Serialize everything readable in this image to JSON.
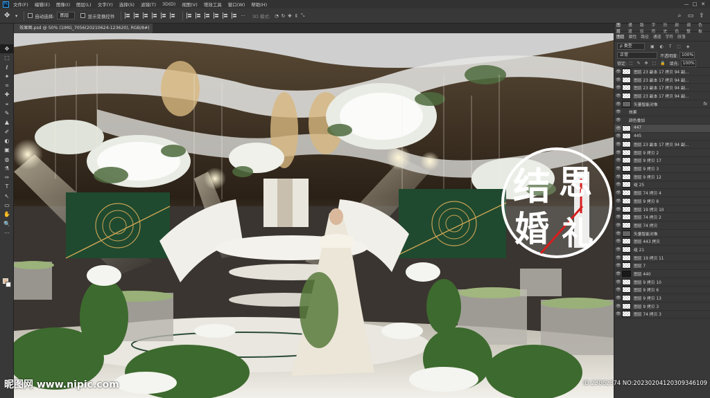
{
  "menu": {
    "items": [
      "文件(F)",
      "编辑(E)",
      "图像(I)",
      "图层(L)",
      "文字(Y)",
      "选择(S)",
      "滤镜(T)",
      "3D(D)",
      "视图(V)",
      "增效工具",
      "窗口(W)",
      "帮助(H)"
    ]
  },
  "window_controls": {
    "minimize": "—",
    "maximize": "□",
    "close": "✕"
  },
  "options": {
    "auto_select_label": "自动选择:",
    "auto_select_value": "图层",
    "show_transform_label": "显示变换控件",
    "mode3d_label": "3D 模式:"
  },
  "document": {
    "tab_title": "效果图.psd @ 50% (1IMG_7056(20210624-123620), RGB/8#)",
    "close_glyph": "×"
  },
  "tools": [
    "✥",
    "⬚",
    "ℓ",
    "✦",
    "⌗",
    "✚",
    "⌖",
    "✎",
    "▲",
    "✐",
    "◐",
    "▣",
    "◍",
    "⚗",
    "✑",
    "T",
    "↖",
    "▭",
    "✋",
    "🔍",
    "⋯"
  ],
  "panel": {
    "tabs_row1": [
      "图层",
      "通道",
      "路径",
      "字符",
      "历史",
      "颜色",
      "调整",
      "色板"
    ],
    "tabs_row2": [
      "图层",
      "属性",
      "路径",
      "通道",
      "字符",
      "段落"
    ],
    "filter_label": "ρ 类型",
    "filter_icons": "▣ ◐ T ⬚ ◈",
    "blend_mode": "正常",
    "opacity_label": "不透明度:",
    "opacity_value": "100%",
    "lock_label": "锁定:",
    "lock_icons": "⬚ ✎ ✥ ⬚ 🔒",
    "fill_label": "填充:",
    "fill_value": "100%"
  },
  "layers": [
    {
      "name": "图层 23 副本 17 拷贝 94 副...",
      "type": "checker",
      "selected": false
    },
    {
      "name": "图层 23 副本 17 拷贝 94 副...",
      "type": "checker",
      "selected": false
    },
    {
      "name": "图层 23 副本 17 拷贝 94 副...",
      "type": "checker",
      "selected": false
    },
    {
      "name": "图层 23 副本 17 拷贝 94 副...",
      "type": "checker",
      "selected": false
    },
    {
      "name": "矢量智能对象",
      "type": "smart",
      "selected": false,
      "fx": "fx"
    },
    {
      "name": "效果",
      "type": "effect",
      "selected": false
    },
    {
      "name": "颜色叠加",
      "type": "effect",
      "selected": false
    },
    {
      "name": "447",
      "type": "checker",
      "selected": true
    },
    {
      "name": "445",
      "type": "checker",
      "selected": false
    },
    {
      "name": "图层 23 副本 17 拷贝 94 副...",
      "type": "checker",
      "selected": false
    },
    {
      "name": "图层 9 拷贝 2",
      "type": "checker",
      "selected": false
    },
    {
      "name": "图层 9 拷贝 17",
      "type": "checker",
      "selected": false
    },
    {
      "name": "图层 9 拷贝 3",
      "type": "checker",
      "selected": false
    },
    {
      "name": "图层 9 拷贝 12",
      "type": "checker",
      "selected": false
    },
    {
      "name": "组 25",
      "type": "checker",
      "selected": false
    },
    {
      "name": "图层 74 拷贝 4",
      "type": "checker",
      "selected": false
    },
    {
      "name": "图层 9 拷贝 8",
      "type": "checker",
      "selected": false
    },
    {
      "name": "图层 19 拷贝 10",
      "type": "checker",
      "selected": false
    },
    {
      "name": "图层 74 拷贝 2",
      "type": "checker",
      "selected": false
    },
    {
      "name": "图层 74 拷贝",
      "type": "checker",
      "selected": false
    },
    {
      "name": "矢量智能对象",
      "type": "smart",
      "selected": false
    },
    {
      "name": "图层 443 拷贝",
      "type": "checker",
      "selected": false
    },
    {
      "name": "组 21",
      "type": "checker",
      "selected": false
    },
    {
      "name": "图层 19 拷贝 11",
      "type": "checker",
      "selected": false
    },
    {
      "name": "图层 7",
      "type": "checker",
      "selected": false
    },
    {
      "name": "图层 440",
      "type": "dark",
      "selected": false
    },
    {
      "name": "图层 9 拷贝 10",
      "type": "checker",
      "selected": false
    },
    {
      "name": "图层 9 拷贝 6",
      "type": "checker",
      "selected": false
    },
    {
      "name": "图层 9 拷贝 13",
      "type": "checker",
      "selected": false
    },
    {
      "name": "图层 9 拷贝 3",
      "type": "checker",
      "selected": false
    },
    {
      "name": "图层 74 拷贝 3",
      "type": "checker",
      "selected": false
    }
  ],
  "canvas_art": {
    "logo_chars": [
      "结",
      "思",
      "婚",
      "礼"
    ]
  },
  "watermark": {
    "site": "昵图网 www.nipic.com",
    "id": "ID:23862374 NO:20230204120309346109"
  }
}
